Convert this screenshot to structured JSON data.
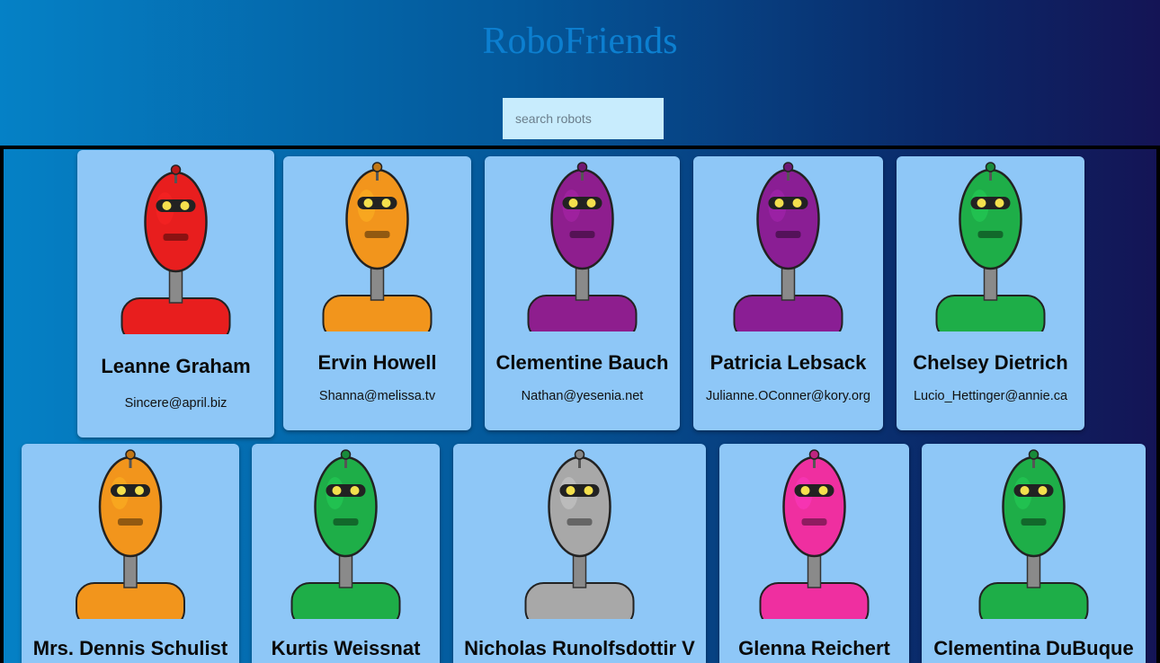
{
  "app": {
    "title": "RoboFriends"
  },
  "search": {
    "placeholder": "search robots"
  },
  "robots": [
    {
      "name": "Leanne Graham",
      "email": "Sincere@april.biz",
      "color": "#e81e1e",
      "icon": "red-robot-icon"
    },
    {
      "name": "Ervin Howell",
      "email": "Shanna@melissa.tv",
      "color": "#f2951c",
      "icon": "orange-robot-icon"
    },
    {
      "name": "Clementine Bauch",
      "email": "Nathan@yesenia.net",
      "color": "#8e1e8e",
      "icon": "purple-robot-icon"
    },
    {
      "name": "Patricia Lebsack",
      "email": "Julianne.OConner@kory.org",
      "color": "#8a1e94",
      "icon": "purple-robot-icon"
    },
    {
      "name": "Chelsey Dietrich",
      "email": "Lucio_Hettinger@annie.ca",
      "color": "#1eae48",
      "icon": "green-robot-icon"
    },
    {
      "name": "Mrs. Dennis Schulist",
      "email": "",
      "color": "#f2951c",
      "icon": "orange-robot-icon"
    },
    {
      "name": "Kurtis Weissnat",
      "email": "",
      "color": "#1eae48",
      "icon": "green-robot-icon"
    },
    {
      "name": "Nicholas Runolfsdottir V",
      "email": "",
      "color": "#a8a8a8",
      "icon": "gray-robot-icon"
    },
    {
      "name": "Glenna Reichert",
      "email": "",
      "color": "#ef2fa0",
      "icon": "pink-robot-icon"
    },
    {
      "name": "Clementina DuBuque",
      "email": "",
      "color": "#1eae48",
      "icon": "green-robot-icon"
    }
  ]
}
